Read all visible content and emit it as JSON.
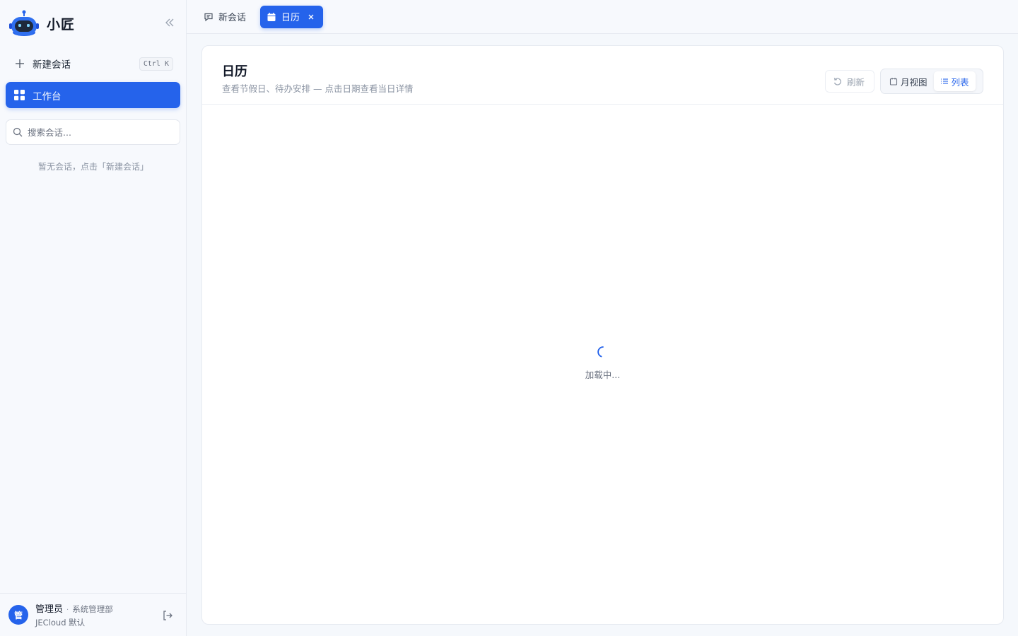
{
  "brand": {
    "name": "小匠",
    "logo_icon": "robot-icon"
  },
  "sidebar": {
    "new_chat_label": "新建会话",
    "new_chat_shortcut": "Ctrl K",
    "workbench_label": "工作台",
    "search_placeholder": "搜索会话...",
    "empty_hint": "暂无会话，点击「新建会话」"
  },
  "user": {
    "avatar_text": "管",
    "name": "管理员",
    "separator": "·",
    "department": "系统管理部",
    "tenant": "JECloud 默认"
  },
  "tabs": [
    {
      "label": "新会话",
      "icon": "chat-icon",
      "active": false
    },
    {
      "label": "日历",
      "icon": "calendar-icon",
      "active": true
    }
  ],
  "calendar": {
    "title": "日历",
    "subtitle": "查看节假日、待办安排 — 点击日期查看当日详情",
    "refresh_label": "刷新",
    "view_month_label": "月视图",
    "view_list_label": "列表",
    "active_view": "列表",
    "loading_text": "加载中..."
  },
  "colors": {
    "accent": "#2563eb",
    "background": "#f5f8fc"
  }
}
